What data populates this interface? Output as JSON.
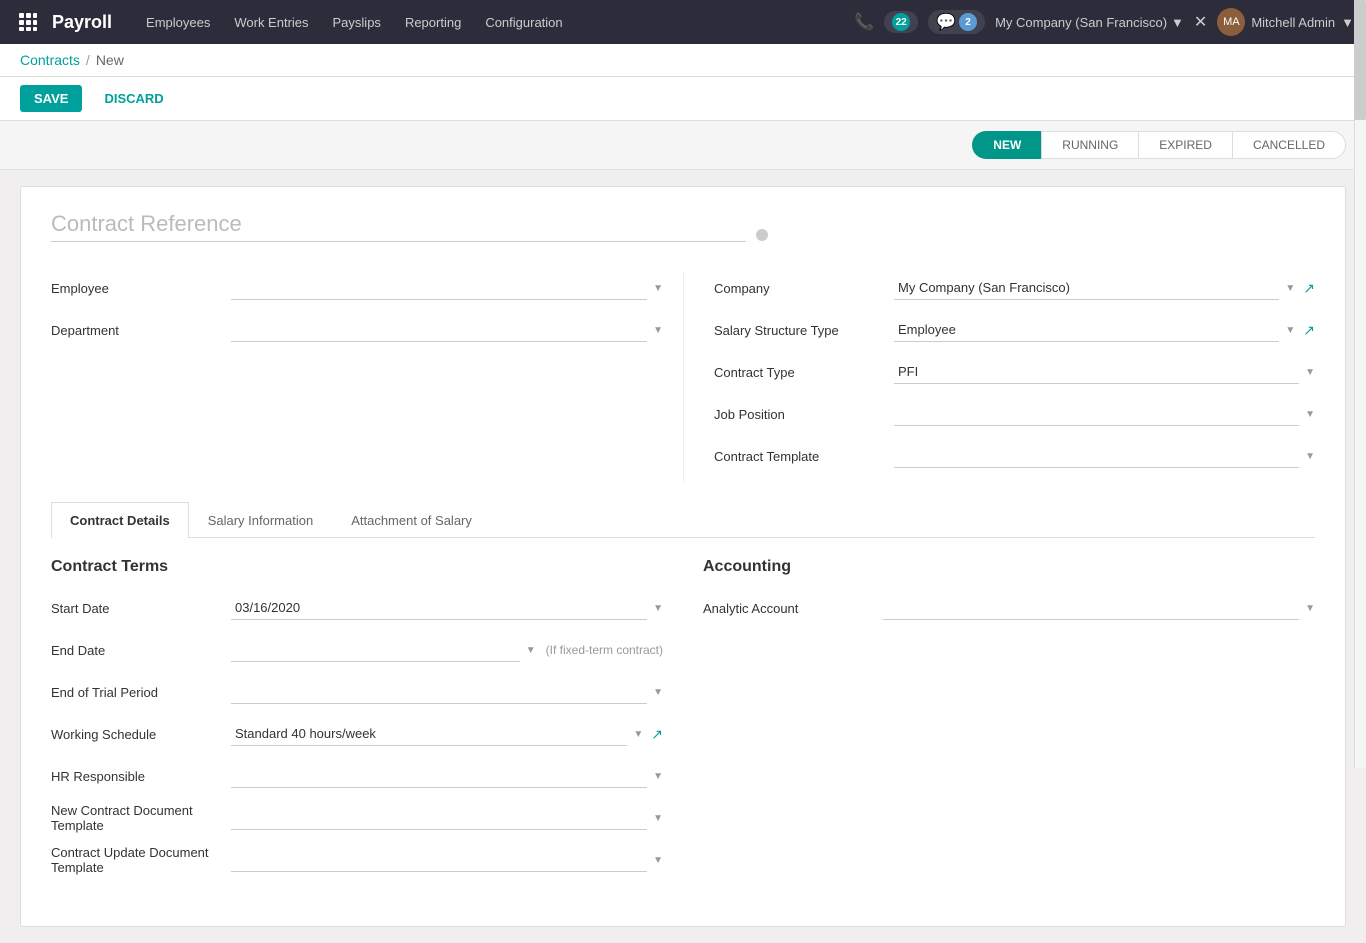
{
  "app": {
    "brand": "Payroll",
    "nav_links": [
      "Employees",
      "Work Entries",
      "Payslips",
      "Reporting",
      "Configuration"
    ],
    "notifications_count": "22",
    "messages_count": "2",
    "company": "My Company (San Francisco)",
    "user": "Mitchell Admin"
  },
  "breadcrumb": {
    "parent": "Contracts",
    "separator": "/",
    "current": "New"
  },
  "actions": {
    "save": "SAVE",
    "discard": "DISCARD"
  },
  "status_steps": [
    "NEW",
    "RUNNING",
    "EXPIRED",
    "CANCELLED"
  ],
  "form": {
    "contract_reference_placeholder": "Contract Reference",
    "left": {
      "employee_label": "Employee",
      "employee_value": "",
      "department_label": "Department",
      "department_value": ""
    },
    "right": {
      "company_label": "Company",
      "company_value": "My Company (San Francisco)",
      "salary_structure_label": "Salary Structure Type",
      "salary_structure_value": "Employee",
      "contract_type_label": "Contract Type",
      "contract_type_value": "PFI",
      "job_position_label": "Job Position",
      "job_position_value": "",
      "contract_template_label": "Contract Template",
      "contract_template_value": ""
    }
  },
  "tabs": {
    "items": [
      "Contract Details",
      "Salary Information",
      "Attachment of Salary"
    ],
    "active": 0
  },
  "contract_terms": {
    "title": "Contract Terms",
    "start_date_label": "Start Date",
    "start_date_value": "03/16/2020",
    "end_date_label": "End Date",
    "end_date_value": "",
    "end_date_hint": "(If fixed-term contract)",
    "trial_period_label": "End of Trial Period",
    "trial_period_value": "",
    "working_schedule_label": "Working Schedule",
    "working_schedule_value": "Standard 40 hours/week",
    "hr_responsible_label": "HR Responsible",
    "hr_responsible_value": "",
    "new_contract_doc_label": "New Contract Document Template",
    "new_contract_doc_value": "",
    "contract_update_label": "Contract Update Document Template",
    "contract_update_value": ""
  },
  "accounting": {
    "title": "Accounting",
    "analytic_account_label": "Analytic Account",
    "analytic_account_value": ""
  }
}
